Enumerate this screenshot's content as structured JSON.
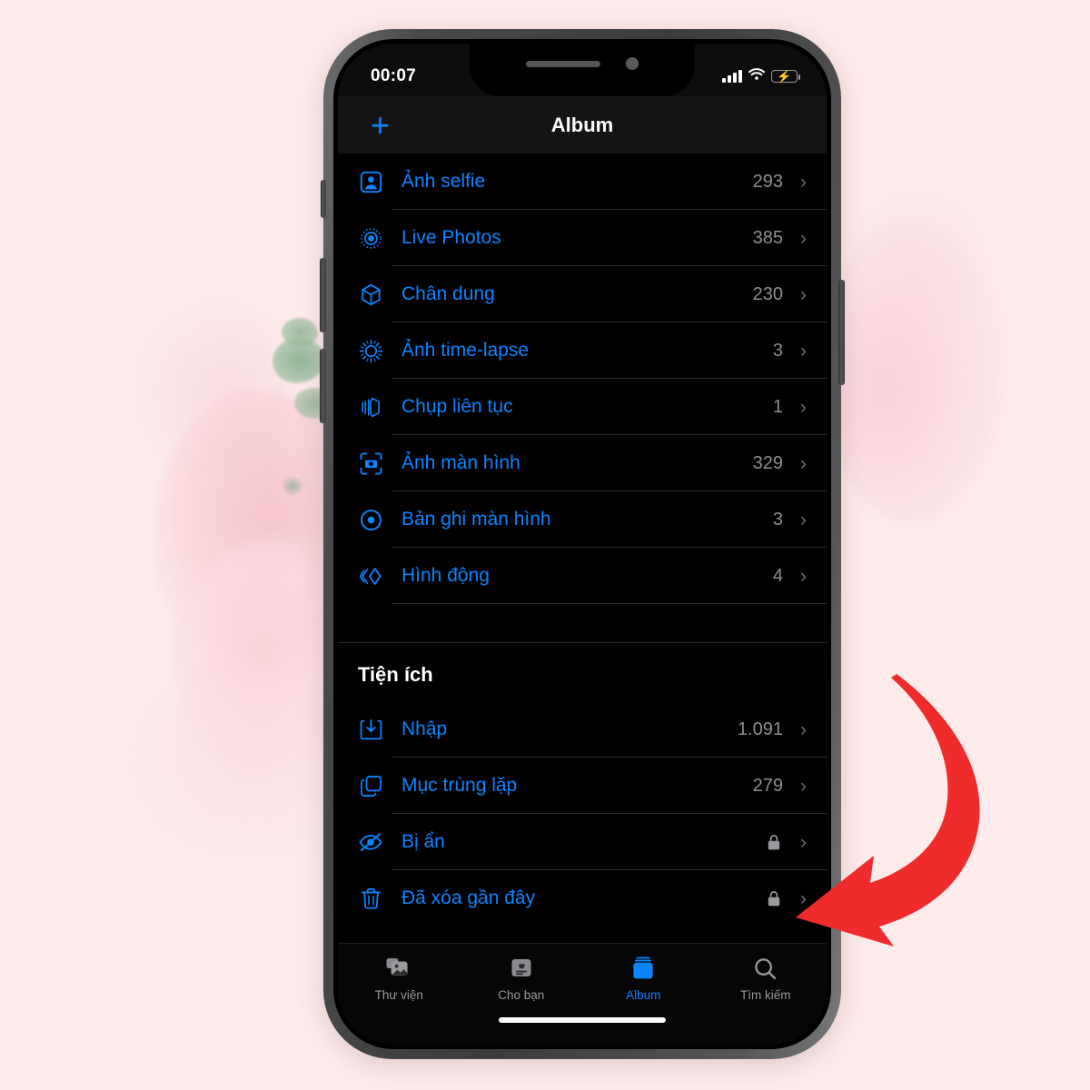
{
  "background": {
    "base_color": "#fdeaea",
    "accent_pink": "#f6c4cb",
    "accent_green": "#96b99b"
  },
  "device": {
    "frame_color": "#4a4a4a",
    "screen_color": "#000000"
  },
  "status_bar": {
    "time": "00:07",
    "signal_icon": "cellular-bars-icon",
    "wifi_icon": "wifi-icon",
    "battery_icon": "battery-charging-icon",
    "battery_color": "#34c759"
  },
  "nav_bar": {
    "add_label": "+",
    "add_icon": "plus-icon",
    "title": "Album",
    "accent": "#0a84ff"
  },
  "media_types": {
    "items": [
      {
        "icon": "portrait-person-icon",
        "label": "Ảnh selfie",
        "count": "293",
        "locked": false
      },
      {
        "icon": "live-photo-icon",
        "label": "Live Photos",
        "count": "385",
        "locked": false
      },
      {
        "icon": "cube-icon",
        "label": "Chân dung",
        "count": "230",
        "locked": false
      },
      {
        "icon": "timelapse-icon",
        "label": "Ảnh time-lapse",
        "count": "3",
        "locked": false
      },
      {
        "icon": "burst-icon",
        "label": "Chụp liên tục",
        "count": "1",
        "locked": false
      },
      {
        "icon": "screenshot-icon",
        "label": "Ảnh màn hình",
        "count": "329",
        "locked": false
      },
      {
        "icon": "screen-record-icon",
        "label": "Bản ghi màn hình",
        "count": "3",
        "locked": false
      },
      {
        "icon": "animated-icon",
        "label": "Hình động",
        "count": "4",
        "locked": false
      }
    ]
  },
  "utilities": {
    "header": "Tiện ích",
    "items": [
      {
        "icon": "import-icon",
        "label": "Nhập",
        "count": "1.091",
        "locked": false
      },
      {
        "icon": "duplicate-icon",
        "label": "Mục trùng lặp",
        "count": "279",
        "locked": false
      },
      {
        "icon": "eye-slash-icon",
        "label": "Bị ẩn",
        "count": "",
        "locked": true
      },
      {
        "icon": "trash-icon",
        "label": "Đã xóa gần đây",
        "count": "",
        "locked": true
      }
    ]
  },
  "tab_bar": {
    "tabs": [
      {
        "icon": "photos-library-icon",
        "label": "Thư viện",
        "active": false
      },
      {
        "icon": "for-you-icon",
        "label": "Cho bạn",
        "active": false
      },
      {
        "icon": "albums-icon",
        "label": "Album",
        "active": true
      },
      {
        "icon": "search-icon",
        "label": "Tìm kiếm",
        "active": false
      }
    ]
  },
  "annotation": {
    "arrow_icon": "curved-arrow-icon",
    "arrow_color": "#f02b2b"
  }
}
